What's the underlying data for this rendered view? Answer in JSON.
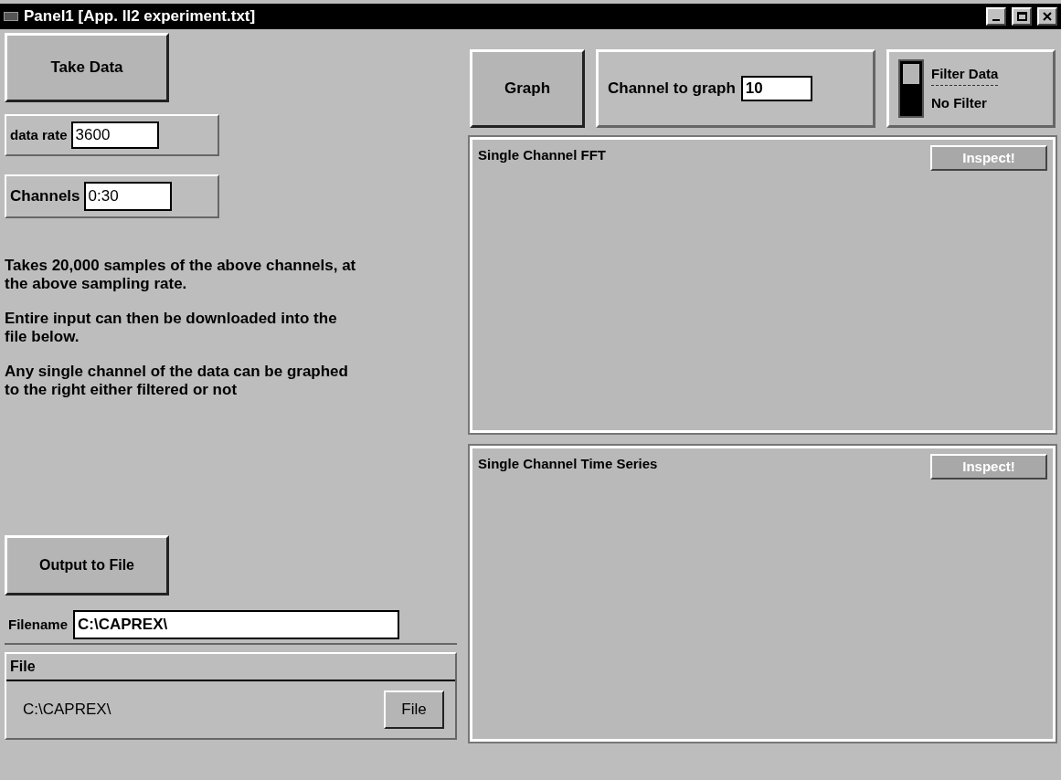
{
  "window": {
    "title": "Panel1 [App. II2 experiment.txt]"
  },
  "take_data_button": "Take Data",
  "data_rate": {
    "label": "data rate",
    "value": "3600"
  },
  "channels": {
    "label": "Channels",
    "value": "0:30"
  },
  "description": [
    "Takes 20,000 samples of the above channels, at the above sampling rate.",
    "Entire input can then be downloaded into the file below.",
    "Any single channel of the data can be graphed to the right either filtered or not"
  ],
  "output_button": "Output to File",
  "filename": {
    "label": "Filename",
    "value": "C:\\CAPREX\\"
  },
  "file_group": {
    "title": "File",
    "path": "C:\\CAPREX\\",
    "button": "File"
  },
  "graph_button": "Graph",
  "channel_to_graph": {
    "label": "Channel to graph",
    "value": "10"
  },
  "filter": {
    "on": false,
    "label": "Filter Data",
    "state_text": "No Filter"
  },
  "panels": [
    {
      "title": "Single Channel FFT",
      "button": "Inspect!",
      "disabled": true
    },
    {
      "title": "Single Channel Time Series",
      "button": "Inspect!",
      "disabled": true
    }
  ]
}
